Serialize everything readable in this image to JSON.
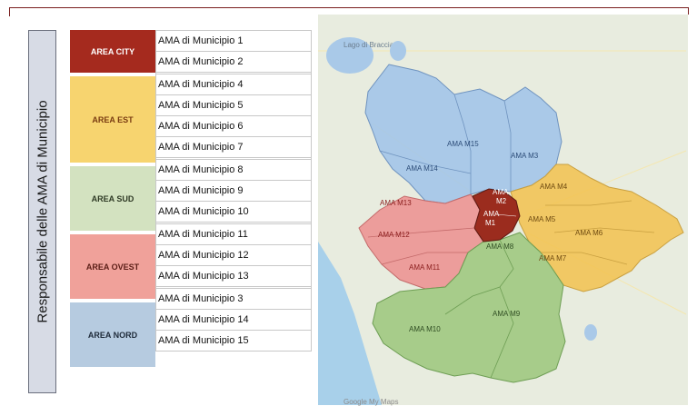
{
  "side_label": "Responsabile delle AMA di Municipio",
  "areas": [
    {
      "label": "AREA CITY",
      "color": "#a52a1e",
      "text_color": "#ffffff",
      "municipi": [
        "AMA di Municipio 1",
        "AMA di Municipio 2"
      ]
    },
    {
      "label": "AREA EST",
      "color": "#f7d46f",
      "text_color": "#7a3c12",
      "municipi": [
        "AMA di Municipio 4",
        "AMA di Municipio 5",
        "AMA di Municipio 6",
        "AMA di Municipio 7"
      ]
    },
    {
      "label": "AREA SUD",
      "color": "#d3e2c0",
      "text_color": "#2f3a25",
      "municipi": [
        "AMA di Municipio 8",
        "AMA di Municipio 9",
        "AMA di Municipio 10"
      ]
    },
    {
      "label": "AREA OVEST",
      "color": "#f0a19a",
      "text_color": "#5c1f18",
      "municipi": [
        "AMA di Municipio 11",
        "AMA di Municipio 12",
        "AMA di Municipio 13"
      ]
    },
    {
      "label": "AREA NORD",
      "color": "#b6cbe0",
      "text_color": "#1f2b3a",
      "municipi": [
        "AMA di Municipio 3",
        "AMA di Municipio 14",
        "AMA di Municipio 15"
      ]
    }
  ],
  "map": {
    "lake_label": "Lago di Bracciano",
    "zones": {
      "m15": "AMA M15",
      "m14": "AMA M14",
      "m3": "AMA M3",
      "m13": "AMA M13",
      "m12": "AMA M12",
      "m11": "AMA M11",
      "m2a": "AMA",
      "m2b": "M2",
      "m1a": "AMA",
      "m1b": "M1",
      "m4": "AMA M4",
      "m5": "AMA M5",
      "m6": "AMA M6",
      "m7": "AMA M7",
      "m8": "AMA M8",
      "m9": "AMA M9",
      "m10": "AMA M10"
    },
    "colors": {
      "nord": "#9fc3ea",
      "est": "#f2c24f",
      "sud": "#9bc77b",
      "ovest": "#ec8f8f",
      "city": "#9b2c1e",
      "water": "#a9c9e8",
      "sea": "#a8d0ea"
    },
    "attribution": "Google My Maps"
  }
}
